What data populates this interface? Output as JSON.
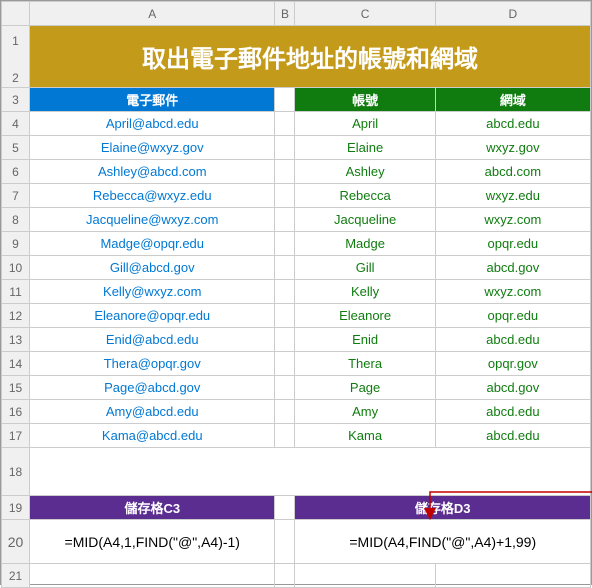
{
  "cols": [
    "A",
    "B",
    "C",
    "D"
  ],
  "title": "取出電子郵件地址的帳號和網域",
  "headers": {
    "email": "電子郵件",
    "account": "帳號",
    "domain": "網域"
  },
  "rows": [
    {
      "n": 4,
      "email": "April@abcd.edu",
      "acc": "April",
      "dom": "abcd.edu"
    },
    {
      "n": 5,
      "email": "Elaine@wxyz.gov",
      "acc": "Elaine",
      "dom": "wxyz.gov"
    },
    {
      "n": 6,
      "email": "Ashley@abcd.com",
      "acc": "Ashley",
      "dom": "abcd.com"
    },
    {
      "n": 7,
      "email": "Rebecca@wxyz.edu",
      "acc": "Rebecca",
      "dom": "wxyz.edu"
    },
    {
      "n": 8,
      "email": "Jacqueline@wxyz.com",
      "acc": "Jacqueline",
      "dom": "wxyz.com"
    },
    {
      "n": 9,
      "email": "Madge@opqr.edu",
      "acc": "Madge",
      "dom": "opqr.edu"
    },
    {
      "n": 10,
      "email": "Gill@abcd.gov",
      "acc": "Gill",
      "dom": "abcd.gov"
    },
    {
      "n": 11,
      "email": "Kelly@wxyz.com",
      "acc": "Kelly",
      "dom": "wxyz.com"
    },
    {
      "n": 12,
      "email": "Eleanore@opqr.edu",
      "acc": "Eleanore",
      "dom": "opqr.edu"
    },
    {
      "n": 13,
      "email": "Enid@abcd.edu",
      "acc": "Enid",
      "dom": "abcd.edu"
    },
    {
      "n": 14,
      "email": "Thera@opqr.gov",
      "acc": "Thera",
      "dom": "opqr.gov"
    },
    {
      "n": 15,
      "email": "Page@abcd.gov",
      "acc": "Page",
      "dom": "abcd.gov"
    },
    {
      "n": 16,
      "email": "Amy@abcd.edu",
      "acc": "Amy",
      "dom": "abcd.edu"
    },
    {
      "n": 17,
      "email": "Kama@abcd.edu",
      "acc": "Kama",
      "dom": "abcd.edu"
    }
  ],
  "cell_c3_label": "儲存格C3",
  "cell_d3_label": "儲存格D3",
  "formula_c": "=MID(A4,1,FIND(\"@\",A4)-1)",
  "formula_d": "=MID(A4,FIND(\"@\",A4)+1,99)",
  "chart_data": {
    "type": "table",
    "title": "取出電子郵件地址的帳號和網域",
    "columns": [
      "電子郵件",
      "帳號",
      "網域"
    ],
    "data": [
      [
        "April@abcd.edu",
        "April",
        "abcd.edu"
      ],
      [
        "Elaine@wxyz.gov",
        "Elaine",
        "wxyz.gov"
      ],
      [
        "Ashley@abcd.com",
        "Ashley",
        "abcd.com"
      ],
      [
        "Rebecca@wxyz.edu",
        "Rebecca",
        "wxyz.edu"
      ],
      [
        "Jacqueline@wxyz.com",
        "Jacqueline",
        "wxyz.com"
      ],
      [
        "Madge@opqr.edu",
        "Madge",
        "opqr.edu"
      ],
      [
        "Gill@abcd.gov",
        "Gill",
        "abcd.gov"
      ],
      [
        "Kelly@wxyz.com",
        "Kelly",
        "wxyz.com"
      ],
      [
        "Eleanore@opqr.edu",
        "Eleanore",
        "opqr.edu"
      ],
      [
        "Enid@abcd.edu",
        "Enid",
        "abcd.edu"
      ],
      [
        "Thera@opqr.gov",
        "Thera",
        "opqr.gov"
      ],
      [
        "Page@abcd.gov",
        "Page",
        "abcd.gov"
      ],
      [
        "Amy@abcd.edu",
        "Amy",
        "abcd.edu"
      ],
      [
        "Kama@abcd.edu",
        "Kama",
        "abcd.edu"
      ]
    ],
    "formulas": {
      "帳號": "=MID(A4,1,FIND(\"@\",A4)-1)",
      "網域": "=MID(A4,FIND(\"@\",A4)+1,99)"
    }
  }
}
